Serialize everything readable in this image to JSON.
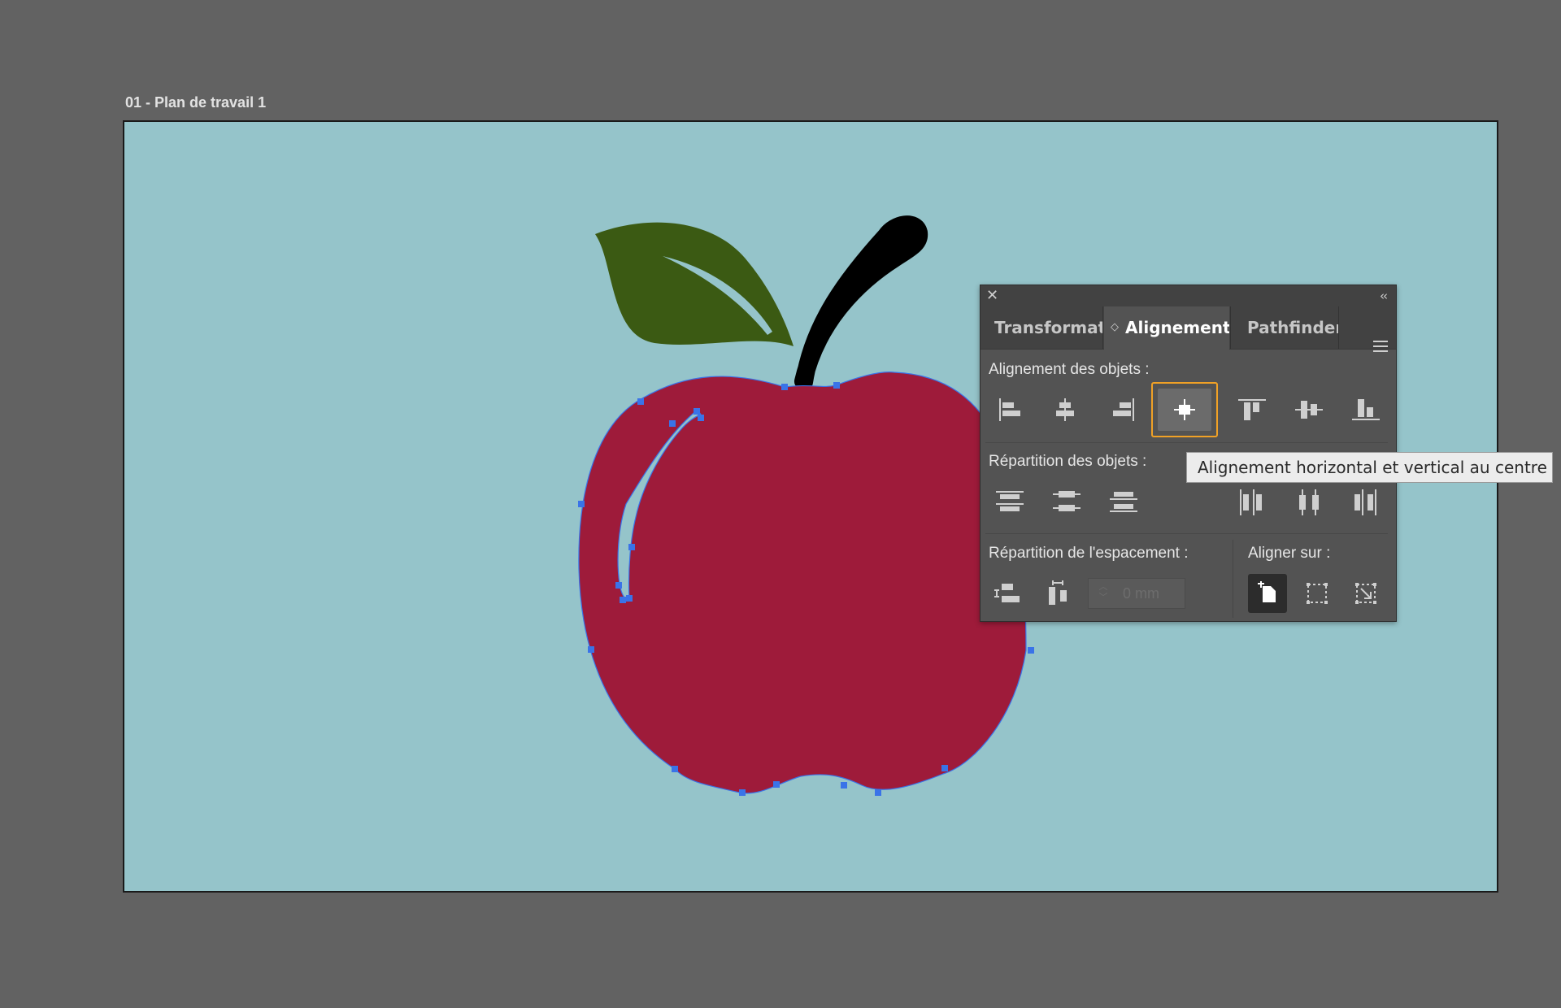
{
  "artboard": {
    "label": "01 - Plan de travail 1",
    "background": "#95c4ca"
  },
  "artwork": {
    "apple_color": "#9e1b3a",
    "leaf_color": "#3b5a13",
    "stem_color": "#000000",
    "selection_color": "#3a73e8"
  },
  "panel": {
    "tabs": [
      {
        "label": "Transformati",
        "active": false
      },
      {
        "label": "Alignement",
        "active": true
      },
      {
        "label": "Pathfinder",
        "active": false
      }
    ],
    "align_objects_label": "Alignement des objets :",
    "distribute_objects_label": "Répartition des objets :",
    "distribute_spacing_label": "Répartition de l'espacement :",
    "align_to_label": "Aligner sur :",
    "spacing_value": "0 mm",
    "selected_button": "align-center-both",
    "accent": "#f0a126"
  },
  "tooltip": {
    "text": "Alignement horizontal et vertical au centre"
  }
}
